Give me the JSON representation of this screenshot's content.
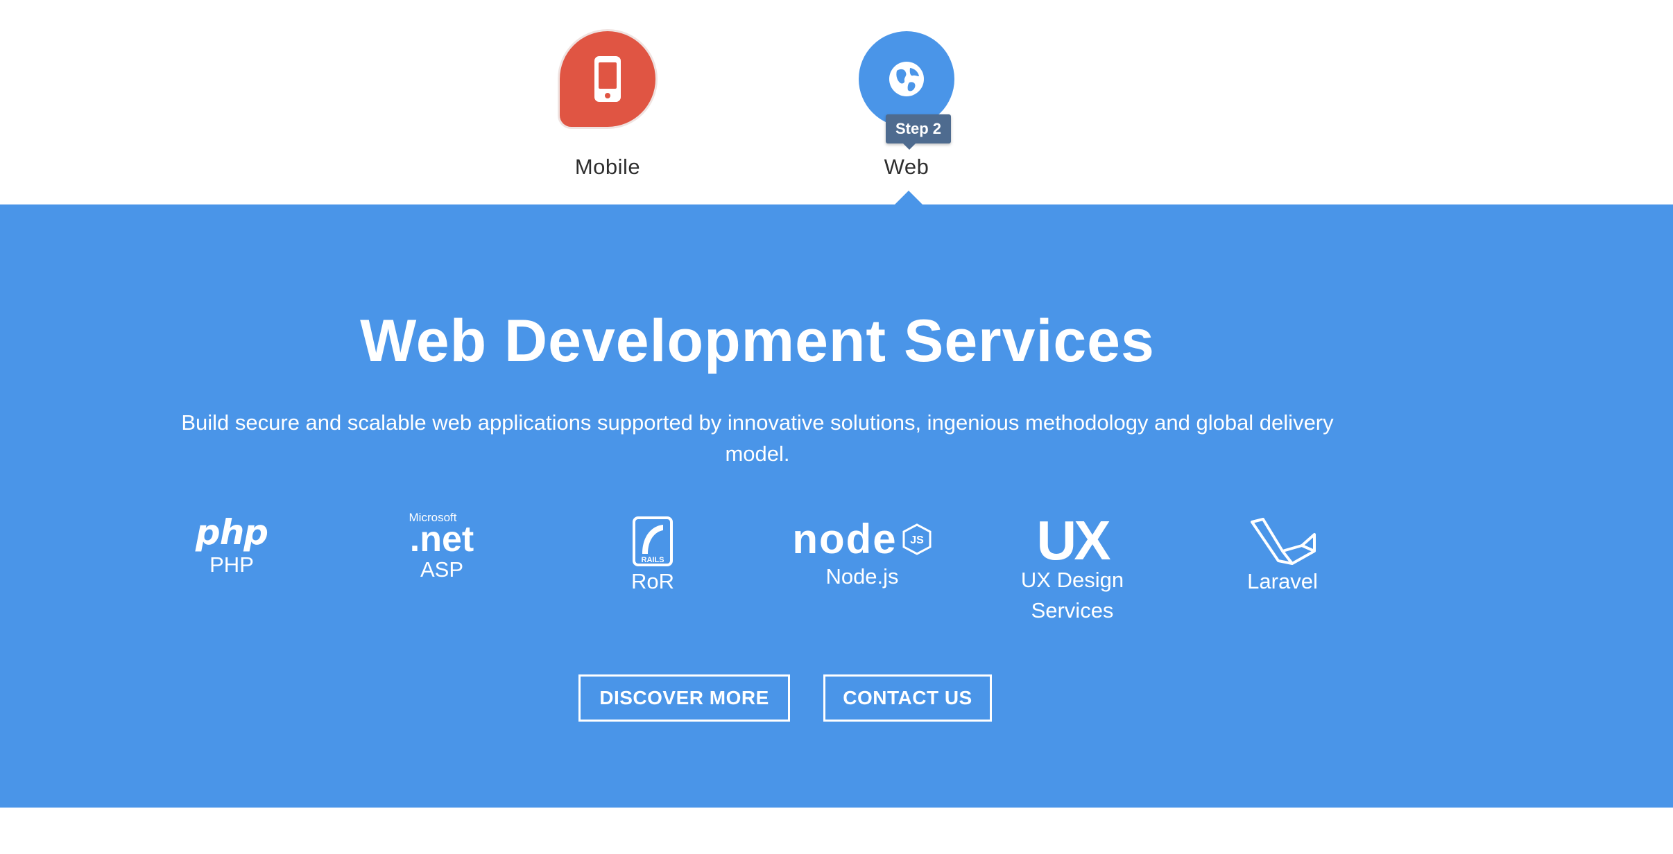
{
  "tabs": [
    {
      "label": "Mobile",
      "icon": "smartphone-icon",
      "color": "#e05543"
    },
    {
      "label": "Web",
      "icon": "globe-icon",
      "color": "#4a95e8",
      "active": true
    }
  ],
  "tooltip": {
    "text": "Step 2"
  },
  "panel": {
    "background": "#4a95e8",
    "title": "Web Development Services",
    "subtitle": "Build secure and scalable web applications supported by innovative solutions, ingenious methodology and global delivery model."
  },
  "technologies": [
    {
      "label": "PHP",
      "logo_text": "php",
      "icon": "php-logo-icon"
    },
    {
      "label": "ASP",
      "logo_small": "Microsoft",
      "logo_text": ".net",
      "icon": "dotnet-logo-icon"
    },
    {
      "label": "RoR",
      "logo_text": "RAILS",
      "icon": "rails-logo-icon"
    },
    {
      "label": "Node.js",
      "logo_text": "node",
      "logo_badge": "JS",
      "icon": "nodejs-logo-icon"
    },
    {
      "label": "UX Design Services",
      "logo_text": "UX",
      "icon": "ux-logo-icon"
    },
    {
      "label": "Laravel",
      "icon": "laravel-logo-icon"
    }
  ],
  "buttons": {
    "discover": "DISCOVER MORE",
    "contact": "CONTACT US"
  }
}
